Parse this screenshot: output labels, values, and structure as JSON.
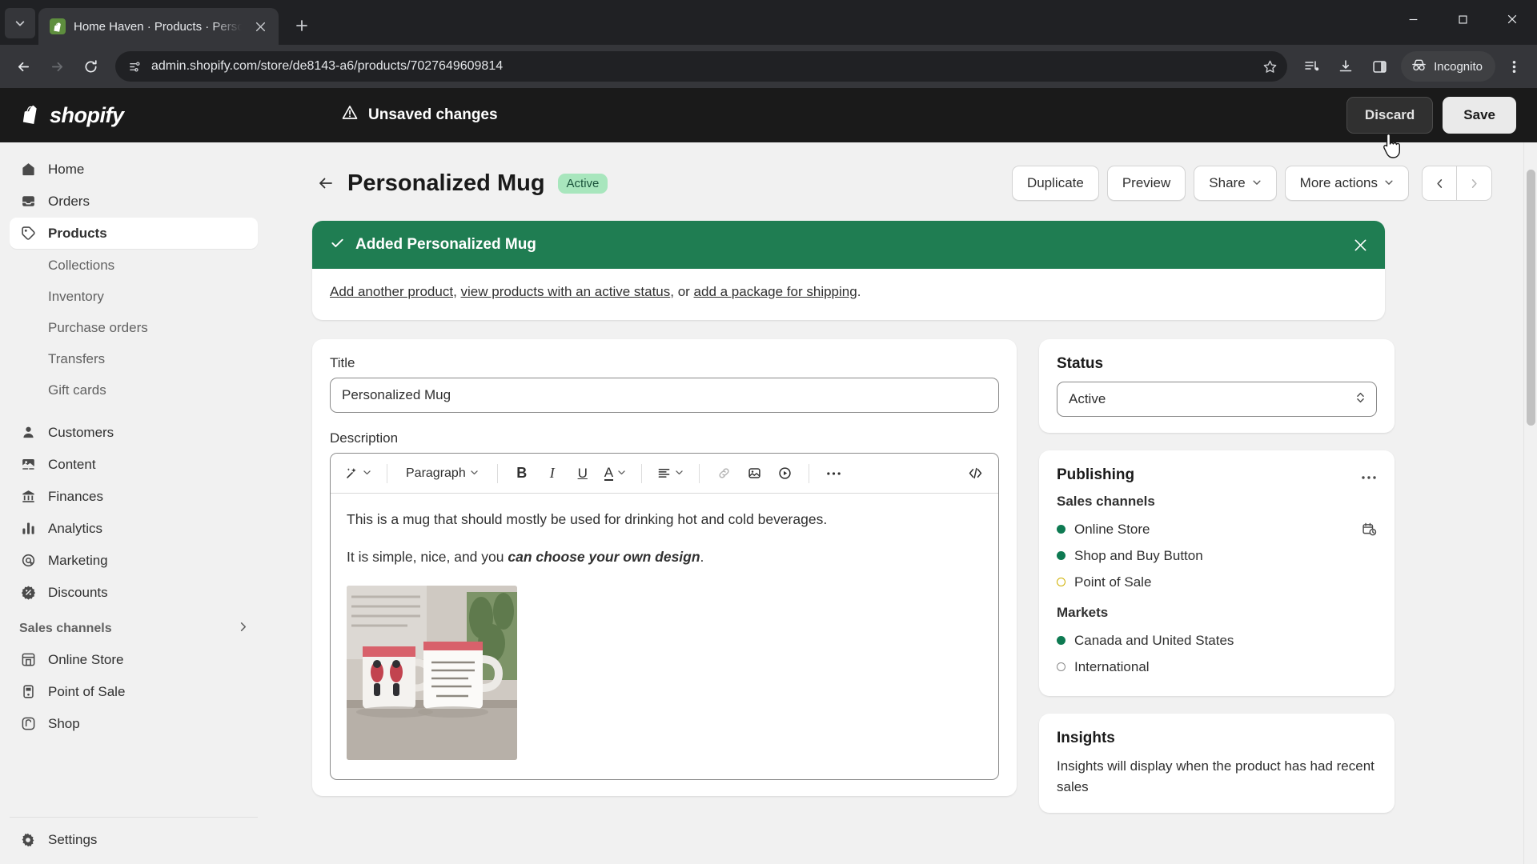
{
  "browser": {
    "tab": {
      "title": "Home Haven · Products · Perso",
      "favicon": "shopify-favicon"
    },
    "url": "admin.shopify.com/store/de8143-a6/products/7027649609814",
    "profile_label": "Incognito",
    "icons": {
      "tab_search": "chevron-down-icon",
      "new_tab": "plus-icon",
      "close_tab": "close-icon",
      "back": "back-arrow-icon",
      "forward": "forward-arrow-icon",
      "reload": "reload-icon",
      "site_info": "page-info-icon",
      "bookmark": "star-icon",
      "media": "media-controls-icon",
      "download": "download-icon",
      "side_panel": "side-panel-icon",
      "incognito": "incognito-icon",
      "menu": "three-dot-menu-icon",
      "minimize": "minimize-icon",
      "maximize": "maximize-icon",
      "win_close": "window-close-icon"
    }
  },
  "topbar": {
    "brand": "shopify",
    "unsaved_text": "Unsaved changes",
    "discard_label": "Discard",
    "save_label": "Save"
  },
  "sidebar": {
    "items": [
      {
        "label": "Home",
        "icon": "home-icon",
        "type": "main",
        "active": false
      },
      {
        "label": "Orders",
        "icon": "orders-inbox-icon",
        "type": "main",
        "active": false
      },
      {
        "label": "Products",
        "icon": "product-tag-icon",
        "type": "main",
        "active": true
      },
      {
        "label": "Collections",
        "icon": "",
        "type": "sub",
        "active": false
      },
      {
        "label": "Inventory",
        "icon": "",
        "type": "sub",
        "active": false
      },
      {
        "label": "Purchase orders",
        "icon": "",
        "type": "sub",
        "active": false
      },
      {
        "label": "Transfers",
        "icon": "",
        "type": "sub",
        "active": false
      },
      {
        "label": "Gift cards",
        "icon": "",
        "type": "sub",
        "active": false
      },
      {
        "label": "Customers",
        "icon": "customer-person-icon",
        "type": "main",
        "active": false
      },
      {
        "label": "Content",
        "icon": "content-image-icon",
        "type": "main",
        "active": false
      },
      {
        "label": "Finances",
        "icon": "finances-bank-icon",
        "type": "main",
        "active": false
      },
      {
        "label": "Analytics",
        "icon": "analytics-bars-icon",
        "type": "main",
        "active": false
      },
      {
        "label": "Marketing",
        "icon": "marketing-target-icon",
        "type": "main",
        "active": false
      },
      {
        "label": "Discounts",
        "icon": "discount-percent-icon",
        "type": "main",
        "active": false
      }
    ],
    "sales_channels_heading": "Sales channels",
    "channels": [
      {
        "label": "Online Store",
        "icon": "online-store-icon"
      },
      {
        "label": "Point of Sale",
        "icon": "point-of-sale-icon"
      },
      {
        "label": "Shop",
        "icon": "shop-bag-icon"
      }
    ],
    "settings_label": "Settings",
    "settings_icon": "gear-icon"
  },
  "page": {
    "title": "Personalized Mug",
    "status_badge": "Active",
    "back_icon": "back-arrow-icon",
    "actions": [
      {
        "label": "Duplicate",
        "caret": false
      },
      {
        "label": "Preview",
        "caret": false
      },
      {
        "label": "Share",
        "caret": true
      },
      {
        "label": "More actions",
        "caret": true
      }
    ],
    "pager": {
      "prev_icon": "chevron-left-icon",
      "next_icon": "chevron-right-icon"
    }
  },
  "banner": {
    "icon": "check-icon",
    "title": "Added Personalized Mug",
    "close_icon": "close-icon",
    "link1": "Add another product",
    "sep1": ", ",
    "link2": "view products with an active status",
    "sep2": ", or ",
    "link3": "add a package for shipping",
    "sep3": "."
  },
  "product": {
    "title_label": "Title",
    "title_value": "Personalized Mug",
    "description_label": "Description",
    "paragraph1": "This is a mug that should mostly be used for drinking hot and cold beverages.",
    "paragraph2_plain": "It is simple, nice, and you ",
    "paragraph2_bold": "can choose your own design",
    "paragraph2_end": ".",
    "image_alt": "personalized-mug-photo"
  },
  "editor_toolbar": {
    "ai_icon": "magic-wand-icon",
    "block_format": "Paragraph",
    "bold": "B",
    "italic": "I",
    "underline": "U",
    "text_color": "A",
    "align_icon": "align-left-icon",
    "link_icon": "link-icon",
    "image_icon": "insert-image-icon",
    "video_icon": "insert-video-icon",
    "more_icon": "ellipsis-icon",
    "code_icon": "code-brackets-icon"
  },
  "status_panel": {
    "title": "Status",
    "value": "Active",
    "arrow_icon": "up-down-chevron-icon"
  },
  "publishing_panel": {
    "title": "Publishing",
    "menu_icon": "ellipsis-icon",
    "sales_channels_label": "Sales channels",
    "sales_channels": [
      {
        "label": "Online Store",
        "state": "green",
        "trailing_icon": "calendar-clock-icon"
      },
      {
        "label": "Shop and Buy Button",
        "state": "green",
        "trailing_icon": ""
      },
      {
        "label": "Point of Sale",
        "state": "yellow",
        "trailing_icon": ""
      }
    ],
    "markets_label": "Markets",
    "markets": [
      {
        "label": "Canada and United States",
        "state": "green"
      },
      {
        "label": "International",
        "state": "empty"
      }
    ]
  },
  "insights_panel": {
    "title": "Insights",
    "text": "Insights will display when the product has had recent sales"
  },
  "colors": {
    "shopify_dark": "#1a1a1a",
    "banner_green": "#1f7d52",
    "badge_green": "#a8e6bd",
    "channel_green": "#0e7a52",
    "channel_yellow": "#cfb000"
  }
}
